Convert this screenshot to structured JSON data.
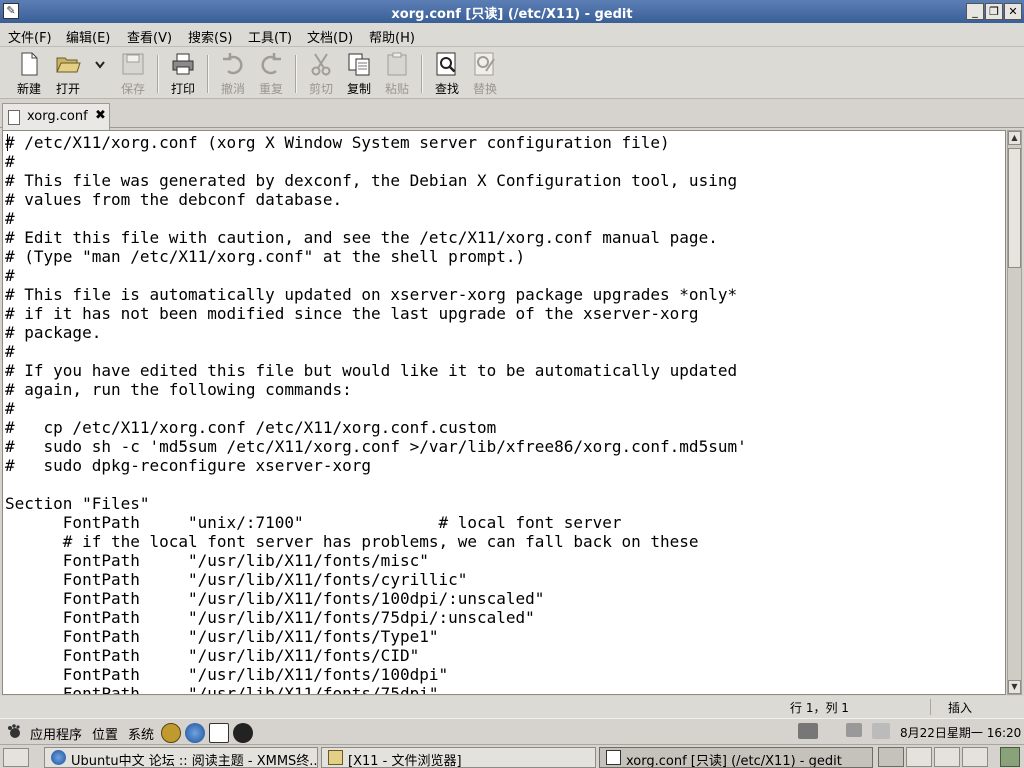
{
  "window": {
    "title": "xorg.conf [只读] (/etc/X11) - gedit"
  },
  "menubar": {
    "items": [
      "文件(F)",
      "编辑(E)",
      "查看(V)",
      "搜索(S)",
      "工具(T)",
      "文档(D)",
      "帮助(H)"
    ]
  },
  "toolbar": {
    "new": "新建",
    "open": "打开",
    "save": "保存",
    "print": "打印",
    "undo": "撤消",
    "redo": "重复",
    "cut": "剪切",
    "copy": "复制",
    "paste": "粘贴",
    "find": "查找",
    "replace": "替换"
  },
  "tab": {
    "label": "xorg.conf",
    "close": "✖"
  },
  "editor": {
    "content": "# /etc/X11/xorg.conf (xorg X Window System server configuration file)\n#\n# This file was generated by dexconf, the Debian X Configuration tool, using\n# values from the debconf database.\n#\n# Edit this file with caution, and see the /etc/X11/xorg.conf manual page.\n# (Type \"man /etc/X11/xorg.conf\" at the shell prompt.)\n#\n# This file is automatically updated on xserver-xorg package upgrades *only*\n# if it has not been modified since the last upgrade of the xserver-xorg\n# package.\n#\n# If you have edited this file but would like it to be automatically updated\n# again, run the following commands:\n#\n#   cp /etc/X11/xorg.conf /etc/X11/xorg.conf.custom\n#   sudo sh -c 'md5sum /etc/X11/xorg.conf >/var/lib/xfree86/xorg.conf.md5sum'\n#   sudo dpkg-reconfigure xserver-xorg\n\nSection \"Files\"\n      FontPath     \"unix/:7100\"              # local font server\n      # if the local font server has problems, we can fall back on these\n      FontPath     \"/usr/lib/X11/fonts/misc\"\n      FontPath     \"/usr/lib/X11/fonts/cyrillic\"\n      FontPath     \"/usr/lib/X11/fonts/100dpi/:unscaled\"\n      FontPath     \"/usr/lib/X11/fonts/75dpi/:unscaled\"\n      FontPath     \"/usr/lib/X11/fonts/Type1\"\n      FontPath     \"/usr/lib/X11/fonts/CID\"\n      FontPath     \"/usr/lib/X11/fonts/100dpi\"\n      FontPath     \"/usr/lib/X11/fonts/75dpi\""
  },
  "statusbar": {
    "position": "行 1，列 1",
    "mode": "插入"
  },
  "panel": {
    "applications": "应用程序",
    "places": "位置",
    "system": "系统",
    "clock": "8月22日星期一 16:20"
  },
  "taskbar": {
    "tasks": [
      "Ubuntu中文 论坛 :: 阅读主题 - XMMS终...",
      "[X11 - 文件浏览器]",
      "xorg.conf [只读] (/etc/X11) - gedit"
    ]
  },
  "colors": {
    "titlebar": "#3a5f97",
    "chrome": "#d6d3ce",
    "editor_bg": "#ffffff"
  },
  "icons": {
    "window": "text-editor-icon",
    "new": "new-document-icon",
    "open": "folder-open-icon",
    "save": "save-icon",
    "print": "printer-icon",
    "undo": "undo-icon",
    "redo": "redo-icon",
    "cut": "scissors-icon",
    "copy": "copy-icon",
    "paste": "paste-icon",
    "find": "find-icon",
    "replace": "replace-icon"
  }
}
